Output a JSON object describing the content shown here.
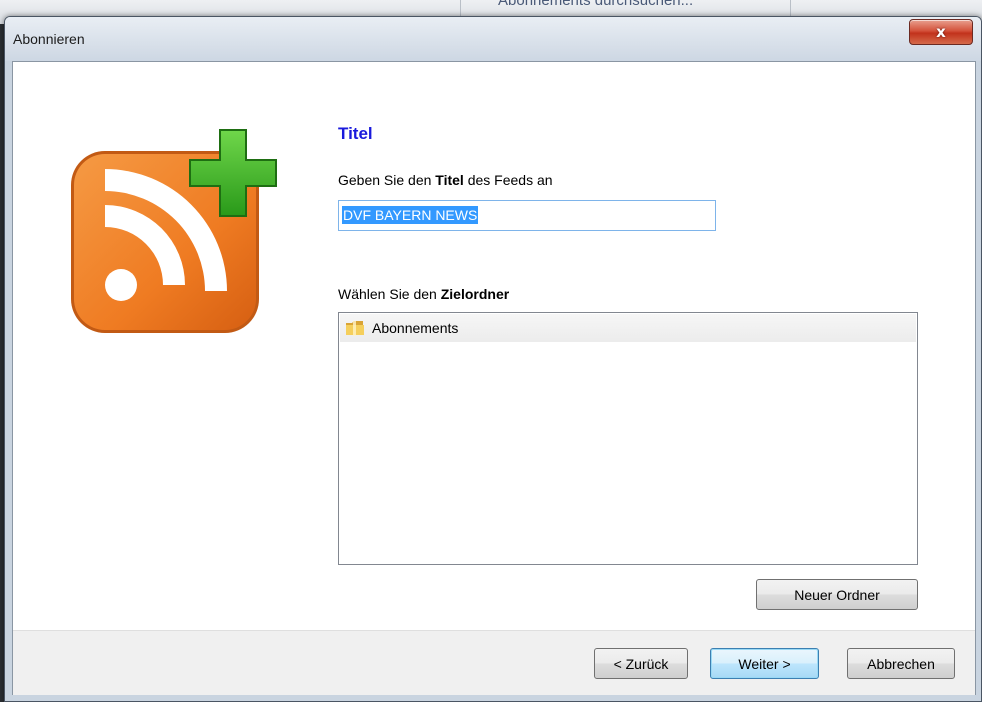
{
  "background_window": {
    "menu_text": "Abonnements durchsuchen..."
  },
  "dialog": {
    "title": "Abonnieren",
    "close_symbol": "x"
  },
  "page": {
    "heading": "Titel",
    "title_prompt_prefix": "Geben Sie den ",
    "title_prompt_bold": "Titel",
    "title_prompt_suffix": " des Feeds an",
    "title_value": "DVF BAYERN NEWS",
    "folder_prompt_prefix": "Wählen Sie den ",
    "folder_prompt_bold": "Zielordner",
    "folders": [
      {
        "label": "Abonnements",
        "icon": "folder-icon"
      }
    ],
    "new_folder_button": "Neuer Ordner"
  },
  "footer": {
    "back_button": "< Zurück",
    "next_button": "Weiter >",
    "cancel_button": "Abbrechen"
  },
  "colors": {
    "heading": "#1a1adc",
    "rss_orange": "#f07a26",
    "plus_green": "#3cae24",
    "selection": "#3399ff"
  }
}
